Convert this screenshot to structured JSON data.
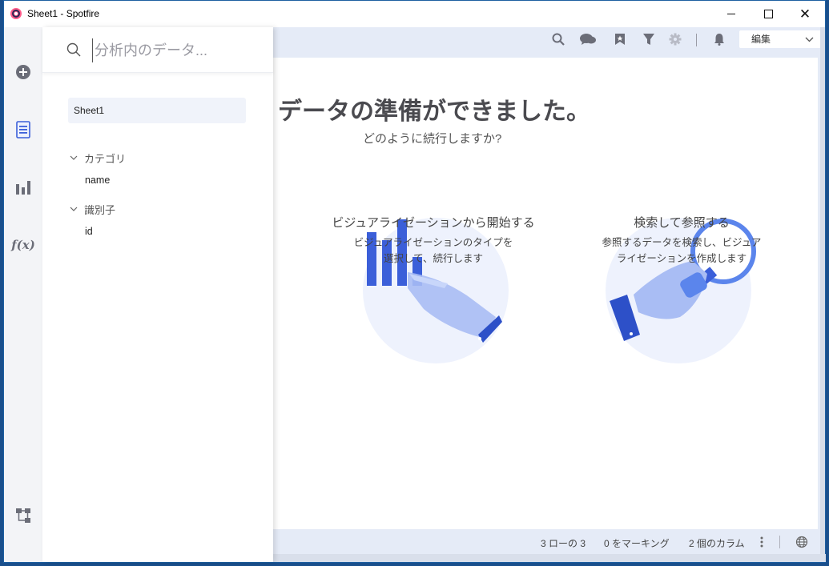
{
  "window": {
    "title": "Sheet1 - Spotfire"
  },
  "rail": {
    "items": [
      {
        "icon": "add-icon"
      },
      {
        "icon": "data-icon"
      },
      {
        "icon": "visualization-icon"
      },
      {
        "icon": "function-icon",
        "label": "f(x)"
      },
      {
        "icon": "data-flow-icon"
      }
    ]
  },
  "panel": {
    "search_placeholder": "分析内のデータ...",
    "table_name": "Sheet1",
    "categories": [
      {
        "label": "カテゴリ",
        "columns": [
          "name"
        ]
      },
      {
        "label": "識別子",
        "columns": [
          "id"
        ]
      }
    ]
  },
  "toolbar": {
    "mode_label": "編集",
    "icons": [
      "search-icon",
      "comments-icon",
      "bookmark-icon",
      "filter-icon",
      "settings-icon",
      "notifications-icon"
    ]
  },
  "main": {
    "title": "データの準備ができました。",
    "subtitle": "どのように続行しますか?",
    "options": [
      {
        "title": "ビジュアライゼーションから開始する",
        "description_line1": "ビジュアライゼーションのタイプを",
        "description_line2": "選択して、続行します"
      },
      {
        "title": "検索して参照する",
        "description_line1": "参照するデータを検索し、ビジュア",
        "description_line2": "ライゼーションを作成します"
      }
    ]
  },
  "status": {
    "rows": "3 ローの 3",
    "marked": "0 をマーキング",
    "columns": "2 個のカラム"
  },
  "colors": {
    "accent": "#3b5fd9",
    "illustration_circle": "#eef2fd",
    "toolbar_bg": "#e5ebf7"
  }
}
